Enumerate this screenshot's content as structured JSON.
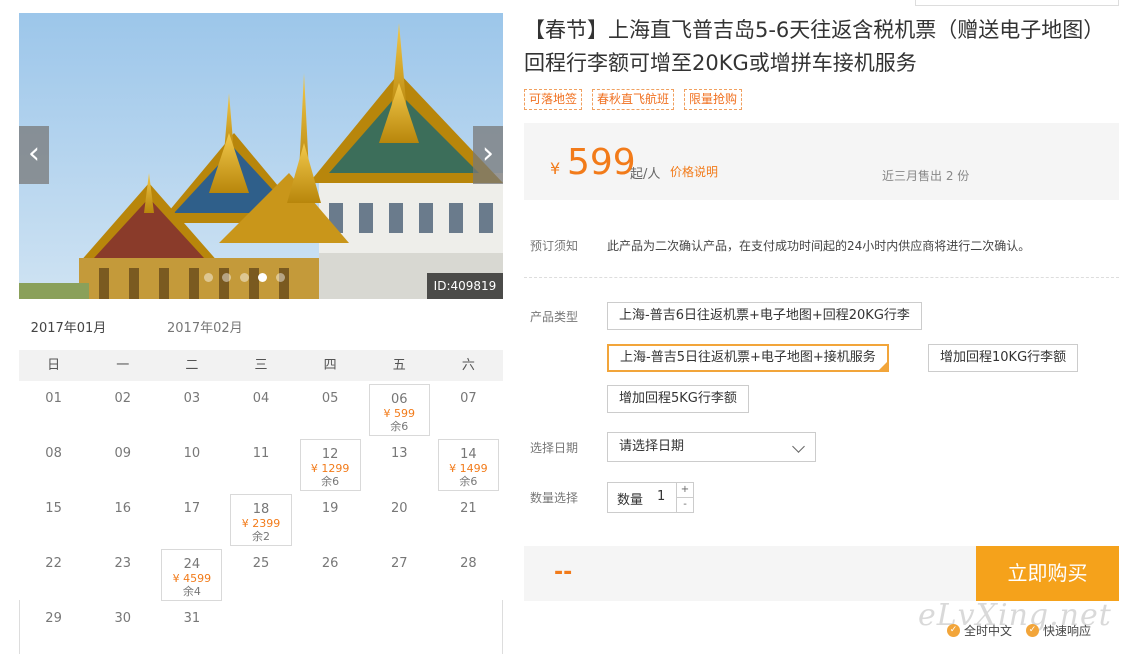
{
  "gallery": {
    "id_label": "ID:409819",
    "prev_glyph": "‹",
    "next_glyph": "›",
    "dot_count": 5,
    "active_dot": 3
  },
  "calendar": {
    "months": [
      "2017年01月",
      "2017年02月"
    ],
    "weekdays": [
      "日",
      "一",
      "二",
      "三",
      "四",
      "五",
      "六"
    ],
    "weeks": [
      [
        {
          "day": "01"
        },
        {
          "day": "02"
        },
        {
          "day": "03"
        },
        {
          "day": "04"
        },
        {
          "day": "05"
        },
        {
          "day": "06",
          "price": "¥ 599",
          "stock": "余6"
        },
        {
          "day": "07"
        }
      ],
      [
        {
          "day": "08"
        },
        {
          "day": "09"
        },
        {
          "day": "10"
        },
        {
          "day": "11"
        },
        {
          "day": "12",
          "price": "¥ 1299",
          "stock": "余6"
        },
        {
          "day": "13"
        },
        {
          "day": "14",
          "price": "¥ 1499",
          "stock": "余6"
        }
      ],
      [
        {
          "day": "15"
        },
        {
          "day": "16"
        },
        {
          "day": "17"
        },
        {
          "day": "18",
          "price": "¥ 2399",
          "stock": "余2"
        },
        {
          "day": "19"
        },
        {
          "day": "20"
        },
        {
          "day": "21"
        }
      ],
      [
        {
          "day": "22"
        },
        {
          "day": "23"
        },
        {
          "day": "24",
          "price": "¥ 4599",
          "stock": "余4"
        },
        {
          "day": "25"
        },
        {
          "day": "26"
        },
        {
          "day": "27"
        },
        {
          "day": "28"
        }
      ],
      [
        {
          "day": "29"
        },
        {
          "day": "30"
        },
        {
          "day": "31"
        },
        {},
        {},
        {},
        {}
      ]
    ]
  },
  "product": {
    "title": "【春节】上海直飞普吉岛5-6天往返含税机票（赠送电子地图）回程行李额可增至20KG或增拼车接机服务",
    "tags": [
      "可落地签",
      "春秋直飞航班",
      "限量抢购"
    ],
    "price": {
      "currency": "¥",
      "value": "599",
      "unit": "起/人",
      "note": "价格说明",
      "sold": "近三月售出 2 份"
    },
    "notice": {
      "label": "预订须知",
      "text": "此产品为二次确认产品，在支付成功时间起的24小时内供应商将进行二次确认。"
    },
    "type": {
      "label": "产品类型",
      "options": [
        "上海-普吉6日往返机票+电子地图+回程20KG行李",
        "上海-普吉5日往返机票+电子地图+接机服务",
        "增加回程10KG行李额",
        "增加回程5KG行李额"
      ],
      "selected_index": 1
    },
    "date": {
      "label": "选择日期",
      "placeholder": "请选择日期"
    },
    "quantity": {
      "label": "数量选择",
      "text": "数量",
      "value": "1",
      "plus": "+",
      "minus": "-"
    },
    "buy": {
      "total": "--",
      "button": "立即购买"
    }
  },
  "footer": {
    "watermark": "eLvXing.net",
    "services": [
      "全时中文",
      "快速响应"
    ]
  },
  "colors": {
    "accent": "#f27b1a",
    "button": "#f5a21b",
    "selected_border": "#f2a53a"
  }
}
